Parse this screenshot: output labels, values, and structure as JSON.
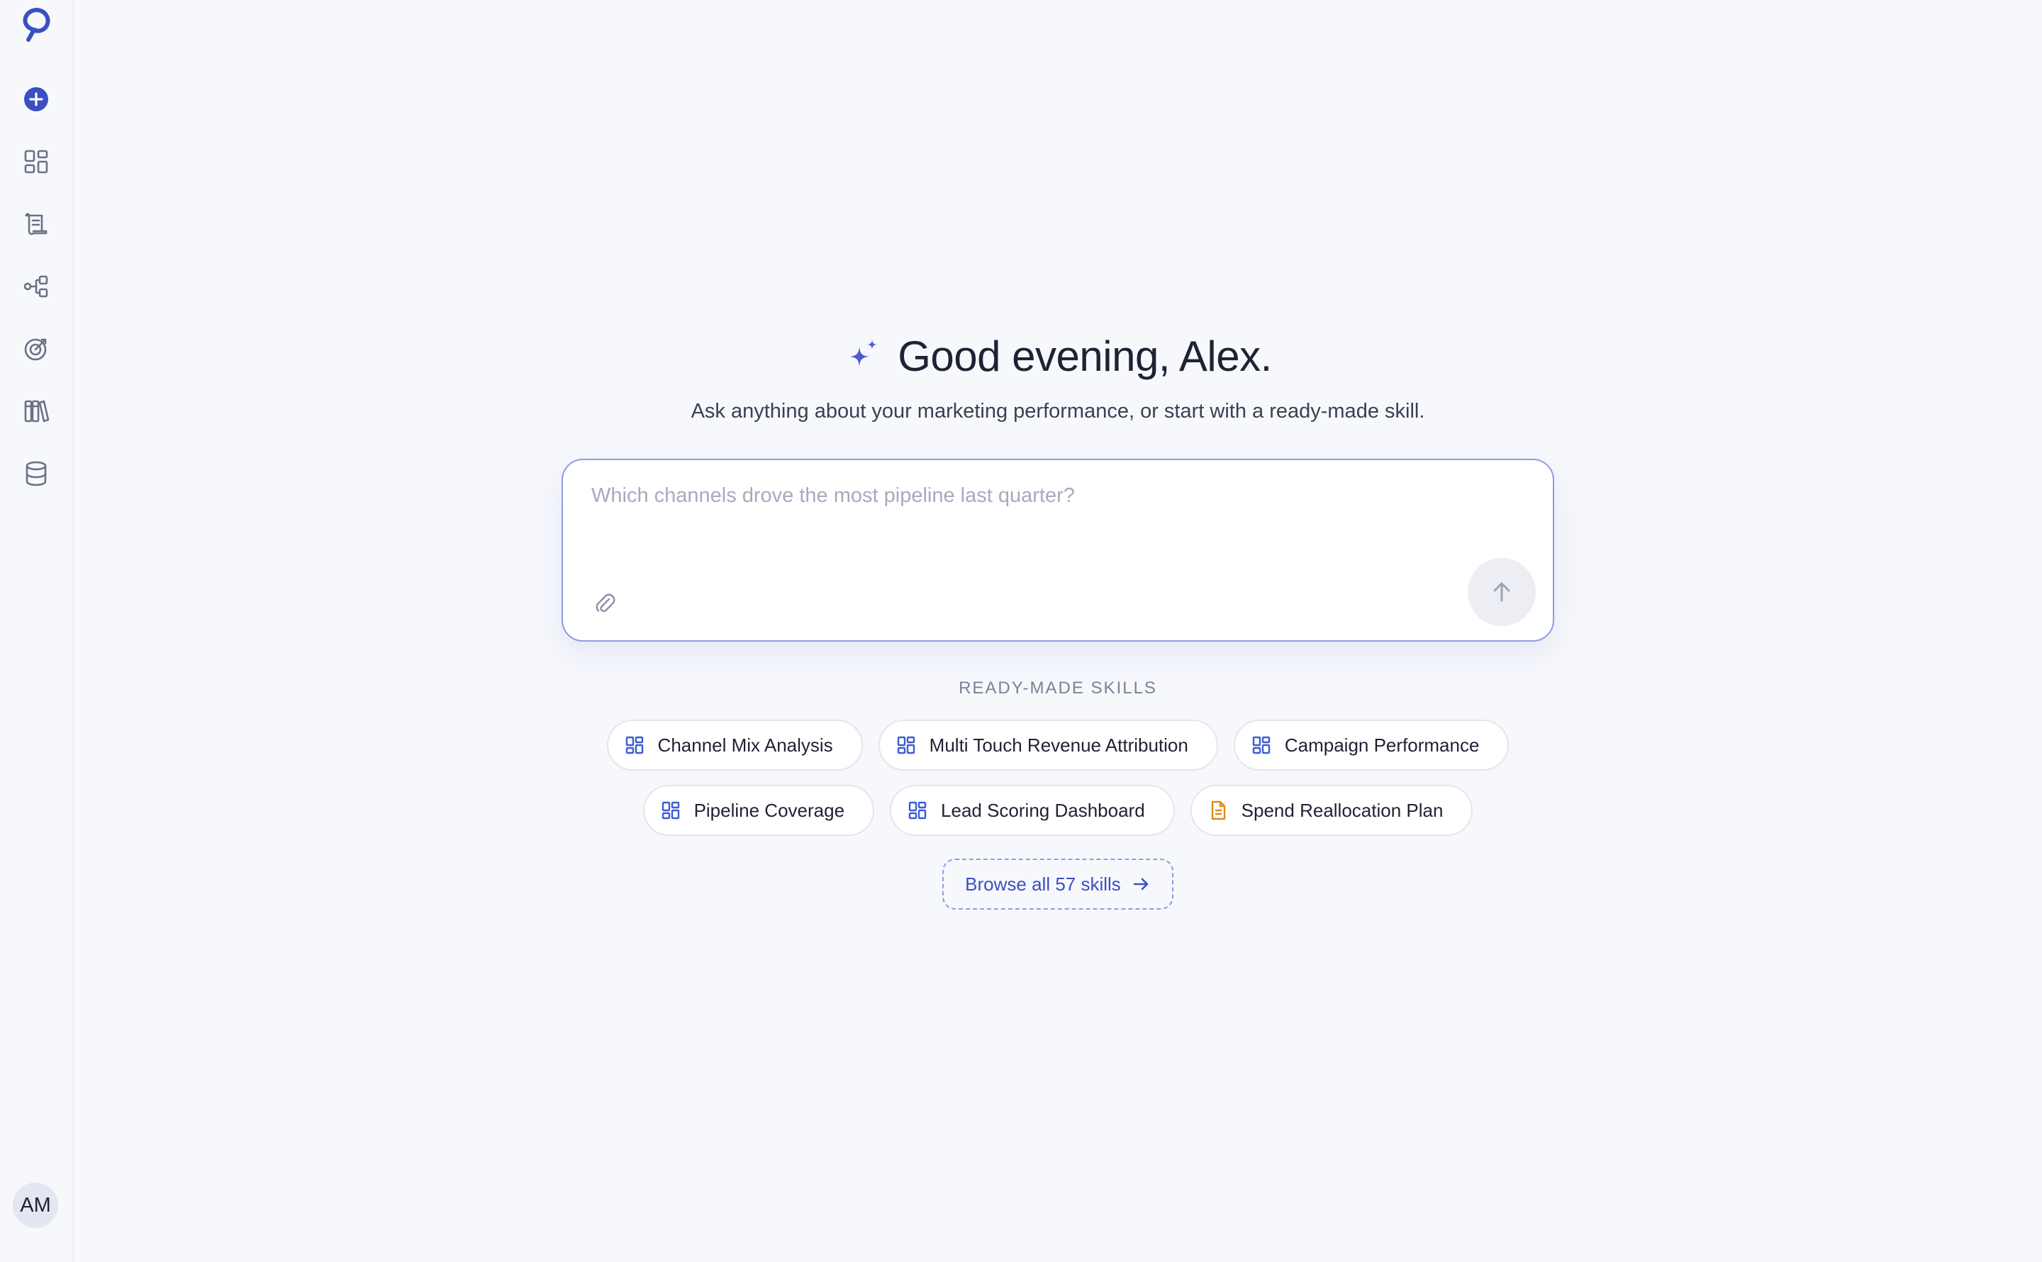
{
  "colors": {
    "accent": "#3b4fc4",
    "sparkle": "#4a5bd6",
    "chip_icon_blue": "#3b5bd6",
    "chip_icon_orange": "#e08a1a",
    "background": "#f7f8fc"
  },
  "sidebar": {
    "items": [
      {
        "icon": "new-chat-icon"
      },
      {
        "icon": "dashboard-grid-icon"
      },
      {
        "icon": "scroll-icon"
      },
      {
        "icon": "flow-icon"
      },
      {
        "icon": "target-icon"
      },
      {
        "icon": "library-icon"
      },
      {
        "icon": "database-icon"
      }
    ],
    "avatar_initials": "AM"
  },
  "hero": {
    "greeting": "Good evening, Alex.",
    "subtitle": "Ask anything about your marketing performance, or start with a ready-made skill."
  },
  "composer": {
    "placeholder": "Which channels drove the most pipeline last quarter?",
    "value": ""
  },
  "skills": {
    "label": "READY-MADE SKILLS",
    "rows": [
      [
        {
          "label": "Channel Mix Analysis",
          "icon": "dashboard-icon"
        },
        {
          "label": "Multi Touch Revenue Attribution",
          "icon": "dashboard-icon"
        },
        {
          "label": "Campaign Performance",
          "icon": "dashboard-icon"
        }
      ],
      [
        {
          "label": "Pipeline Coverage",
          "icon": "dashboard-icon"
        },
        {
          "label": "Lead Scoring Dashboard",
          "icon": "dashboard-icon"
        },
        {
          "label": "Spend Reallocation Plan",
          "icon": "document-icon"
        }
      ]
    ],
    "browse_label": "Browse all 57 skills"
  }
}
